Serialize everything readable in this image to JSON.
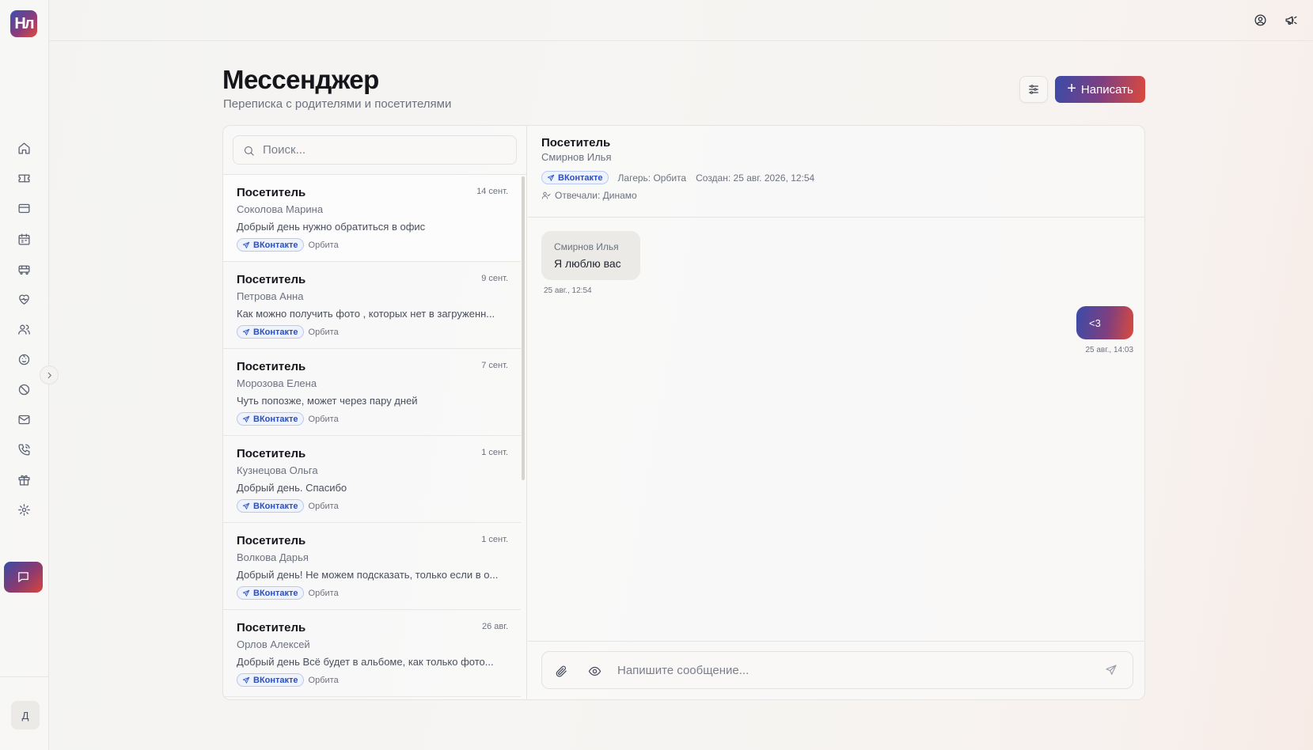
{
  "sidebar": {
    "logo_text": "Нл",
    "nav_items": [
      {
        "name": "home",
        "icon": "home-icon"
      },
      {
        "name": "tickets",
        "icon": "ticket-icon"
      },
      {
        "name": "payments",
        "icon": "credit-card-icon"
      },
      {
        "name": "calendar",
        "icon": "calendar-icon"
      },
      {
        "name": "transport",
        "icon": "bus-icon"
      },
      {
        "name": "health",
        "icon": "heart-pulse-icon"
      },
      {
        "name": "users",
        "icon": "users-icon"
      },
      {
        "name": "kids",
        "icon": "baby-icon"
      },
      {
        "name": "restrictions",
        "icon": "ban-icon"
      },
      {
        "name": "mail",
        "icon": "mail-icon"
      },
      {
        "name": "calls",
        "icon": "phone-icon"
      },
      {
        "name": "gifts",
        "icon": "gift-icon"
      },
      {
        "name": "settings",
        "icon": "gear-icon"
      },
      {
        "name": "messenger",
        "icon": "message-icon",
        "active": true
      }
    ],
    "user_initial": "Д"
  },
  "topbar": {
    "icons": [
      "user-circle-icon",
      "megaphone-icon"
    ]
  },
  "header": {
    "title": "Мессенджер",
    "subtitle": "Переписка с родителями и посетителями",
    "compose_label": "Написать"
  },
  "search": {
    "placeholder": "Поиск..."
  },
  "conversations": [
    {
      "title": "Посетитель",
      "name": "Соколова Марина",
      "date": "14 сент.",
      "preview": "Добрый день нужно обратиться в офис",
      "channel": "ВКонтакте",
      "camp": "Орбита"
    },
    {
      "title": "Посетитель",
      "name": "Петрова Анна",
      "date": "9 сент.",
      "preview": "Как можно получить фото , которых нет в загруженн...",
      "channel": "ВКонтакте",
      "camp": "Орбита"
    },
    {
      "title": "Посетитель",
      "name": "Морозова Елена",
      "date": "7 сент.",
      "preview": "Чуть попозже, может через пару дней",
      "channel": "ВКонтакте",
      "camp": "Орбита"
    },
    {
      "title": "Посетитель",
      "name": "Кузнецова Ольга",
      "date": "1 сент.",
      "preview": "Добрый день. Спасибо",
      "channel": "ВКонтакте",
      "camp": "Орбита"
    },
    {
      "title": "Посетитель",
      "name": "Волкова Дарья",
      "date": "1 сент.",
      "preview": "Добрый день! Не можем подсказать, только если в о...",
      "channel": "ВКонтакте",
      "camp": "Орбита"
    },
    {
      "title": "Посетитель",
      "name": "Орлов Алексей",
      "date": "26 авг.",
      "preview": "Добрый день Всё будет в альбоме, как только фото...",
      "channel": "ВКонтакте",
      "camp": "Орбита"
    }
  ],
  "chat": {
    "title": "Посетитель",
    "name": "Смирнов Илья",
    "channel": "ВКонтакте",
    "camp": "Лагерь: Орбита",
    "created": "Создан: 25 авг. 2026, 12:54",
    "responders": "Отвечали: Динамо",
    "messages": [
      {
        "direction": "in",
        "sender": "Смирнов Илья",
        "text": "Я люблю вас",
        "time": "25 авг., 12:54"
      },
      {
        "direction": "out",
        "text": "<3",
        "time": "25 авг., 14:03"
      }
    ],
    "composer_placeholder": "Напишите сообщение..."
  },
  "colors": {
    "accent_start": "#3a4ba8",
    "accent_end": "#dc4a3c",
    "vk_blue": "#2c4fbf"
  }
}
